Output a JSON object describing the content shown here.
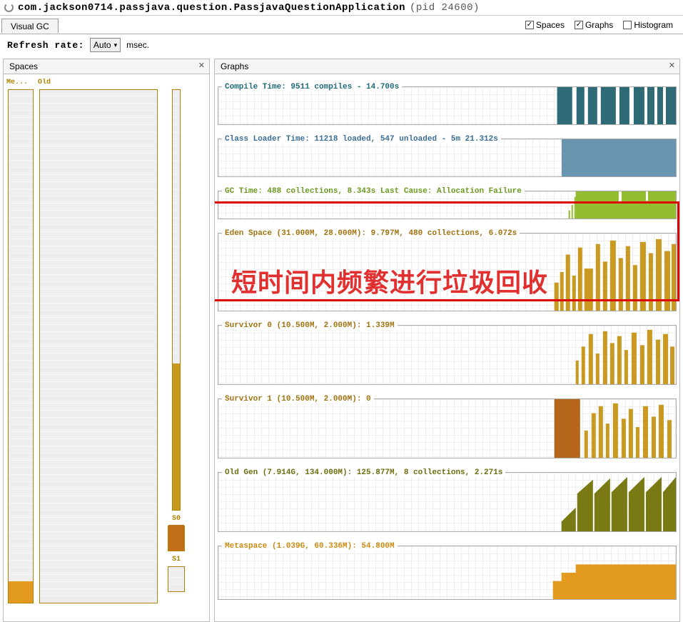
{
  "title": {
    "app": "com.jackson0714.passjava.question.PassjavaQuestionApplication",
    "pid": "(pid 24600)"
  },
  "tab": "Visual GC",
  "checkboxes": {
    "spaces": "Spaces",
    "graphs": "Graphs",
    "histogram": "Histogram"
  },
  "refresh": {
    "label": "Refresh rate:",
    "value": "Auto",
    "unit": "msec."
  },
  "panels": {
    "spaces": "Spaces",
    "graphs": "Graphs"
  },
  "spaces": {
    "me": "Me...",
    "old": "Old",
    "s0": "S0",
    "s1": "S1"
  },
  "graphs": {
    "compile": "Compile Time: 9511 compiles - 14.700s",
    "classloader": "Class Loader Time: 11218 loaded, 547 unloaded - 5m 21.312s",
    "gctime": "GC Time: 488 collections, 8.343s  Last Cause: Allocation Failure",
    "eden": "Eden Space (31.000M, 28.000M): 9.797M, 480 collections, 6.072s",
    "s0": "Survivor 0 (10.500M, 2.000M): 1.339M",
    "s1": "Survivor 1 (10.500M, 2.000M): 0",
    "oldgen": "Old Gen (7.914G, 134.000M): 125.877M, 8 collections, 2.271s",
    "metaspace": "Metaspace (1.039G, 60.336M): 54.800M"
  },
  "annotation": "短时间内频繁进行垃圾回收",
  "chart_data": [
    {
      "type": "area",
      "name": "Compile Time",
      "color": "#2e6b77",
      "fill_from_pct": 74,
      "height_pct": 100,
      "notches": true
    },
    {
      "type": "area",
      "name": "Class Loader Time",
      "color": "#6a95b1",
      "fill_from_pct": 75,
      "height_pct": 100,
      "notches": false
    },
    {
      "type": "area",
      "name": "GC Time",
      "color": "#93bd2e",
      "fill_from_pct": 78,
      "height_pct": 100,
      "spikes_before": true
    },
    {
      "type": "spikes",
      "name": "Eden Space",
      "color": "#c99a1f",
      "region_from_pct": 72,
      "max_height_pct": 90
    },
    {
      "type": "spikes",
      "name": "Survivor 0",
      "color": "#c99a1f",
      "region_from_pct": 78,
      "max_height_pct": 85
    },
    {
      "type": "spikes",
      "name": "Survivor 1",
      "color": "#b5661a",
      "region_from_pct": 72,
      "max_height_pct": 90,
      "solid_left_block": true
    },
    {
      "type": "sawtooth",
      "name": "Old Gen",
      "color": "#7a7a14",
      "region_from_pct": 75,
      "peaks": 6,
      "max_height_pct": 90
    },
    {
      "type": "step",
      "name": "Metaspace",
      "color": "#e39b1f",
      "region_from_pct": 72,
      "height_pct": 68
    }
  ]
}
